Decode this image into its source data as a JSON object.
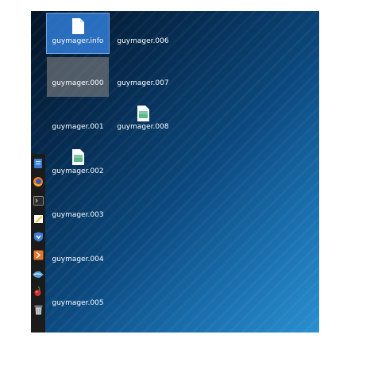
{
  "desktop": {
    "files": [
      {
        "name": "guymager.info",
        "state": "selected",
        "icon": "document-icon"
      },
      {
        "name": "guymager.000",
        "state": "hover",
        "icon": "none"
      },
      {
        "name": "guymager.001",
        "state": "normal",
        "icon": "none"
      },
      {
        "name": "guymager.002",
        "state": "normal",
        "icon": "image-file-icon"
      },
      {
        "name": "guymager.003",
        "state": "normal",
        "icon": "none"
      },
      {
        "name": "guymager.004",
        "state": "normal",
        "icon": "none"
      },
      {
        "name": "guymager.005",
        "state": "normal",
        "icon": "none"
      },
      {
        "name": "guymager.006",
        "state": "normal",
        "icon": "none"
      },
      {
        "name": "guymager.007",
        "state": "normal",
        "icon": "none"
      },
      {
        "name": "guymager.008",
        "state": "normal",
        "icon": "image-file-icon"
      }
    ]
  },
  "dock": {
    "items": [
      {
        "icon": "file-manager-icon",
        "color": "#3a7fd6"
      },
      {
        "icon": "firefox-icon",
        "color": "#f17a1a"
      },
      {
        "icon": "terminal-icon",
        "color": "#2b2b2b"
      },
      {
        "icon": "text-editor-icon",
        "color": "#f3c23a"
      },
      {
        "icon": "metasploit-icon",
        "color": "#3f7fd8"
      },
      {
        "icon": "burp-suite-icon",
        "color": "#e8762b"
      },
      {
        "icon": "wireshark-icon",
        "color": "#5aa0dc"
      },
      {
        "icon": "cherrytree-icon",
        "color": "#d32f2f"
      },
      {
        "icon": "trash-icon",
        "color": "#9aa0a6"
      }
    ]
  }
}
